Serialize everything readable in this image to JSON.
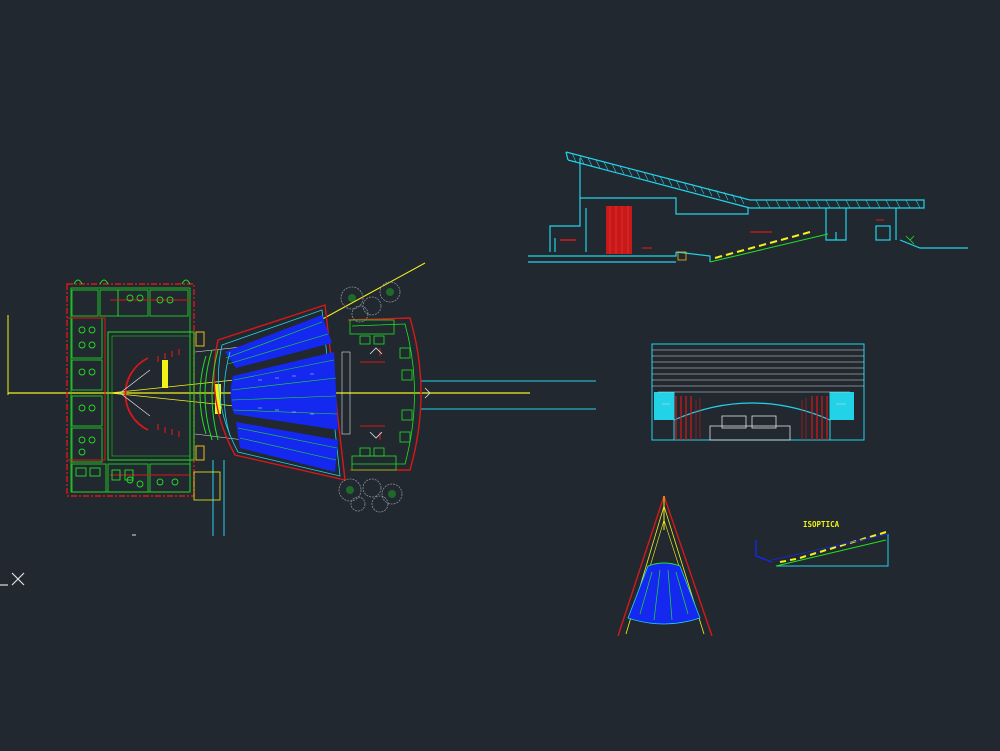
{
  "drawing": {
    "background": "#212830",
    "colors": {
      "cyan": "#22d3e8",
      "yellow": "#f2f21a",
      "red": "#d81818",
      "green": "#22e022",
      "blue": "#1428f0",
      "white": "#e0e0e0",
      "gray": "#8a8f96"
    },
    "labels": {
      "isoptica": "ISOPTICA"
    },
    "ucs_icon": "ucs-axis-icon"
  }
}
